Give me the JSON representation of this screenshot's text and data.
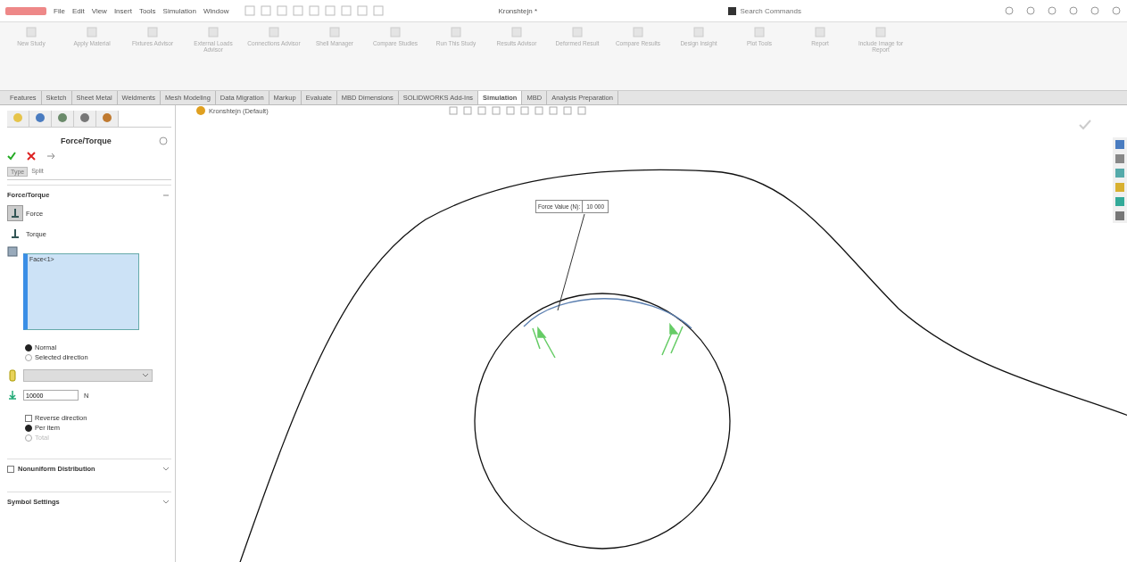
{
  "app": {
    "menu": [
      "File",
      "Edit",
      "View",
      "Insert",
      "Tools",
      "Simulation",
      "Window"
    ],
    "document_title": "Kronshtejn *",
    "search": {
      "placeholder": "Search Commands"
    }
  },
  "ribbon": [
    {
      "label": "New Study"
    },
    {
      "label": "Apply Material"
    },
    {
      "label": "Fixtures Advisor"
    },
    {
      "label": "External Loads Advisor"
    },
    {
      "label": "Connections Advisor"
    },
    {
      "label": "Shell Manager"
    },
    {
      "label": "Compare Studies"
    },
    {
      "label": "Run This Study"
    },
    {
      "label": "Results Advisor"
    },
    {
      "label": "Deformed Result"
    },
    {
      "label": "Compare Results"
    },
    {
      "label": "Design Insight"
    },
    {
      "label": "Plot Tools"
    },
    {
      "label": "Report"
    },
    {
      "label": "Include Image for Report"
    }
  ],
  "tabs": [
    {
      "label": "Features",
      "selected": false
    },
    {
      "label": "Sketch",
      "selected": false
    },
    {
      "label": "Sheet Metal",
      "selected": false
    },
    {
      "label": "Weldments",
      "selected": false
    },
    {
      "label": "Mesh Modeling",
      "selected": false
    },
    {
      "label": "Data Migration",
      "selected": false
    },
    {
      "label": "Markup",
      "selected": false
    },
    {
      "label": "Evaluate",
      "selected": false
    },
    {
      "label": "MBD Dimensions",
      "selected": false
    },
    {
      "label": "SOLIDWORKS Add-Ins",
      "selected": false
    },
    {
      "label": "Simulation",
      "selected": true
    },
    {
      "label": "MBD",
      "selected": false
    },
    {
      "label": "Analysis Preparation",
      "selected": false
    }
  ],
  "panel": {
    "title": "Force/Torque",
    "subtabs": [
      {
        "label": "Type",
        "selected": true
      },
      {
        "label": "Split",
        "selected": false
      }
    ],
    "section": "Force/Torque",
    "load_types": [
      {
        "label": "Force",
        "selected": true
      },
      {
        "label": "Torque",
        "selected": false
      }
    ],
    "faces": [
      "Face<1>"
    ],
    "direction": [
      {
        "label": "Normal",
        "selected": true
      },
      {
        "label": "Selected direction",
        "selected": false
      }
    ],
    "value": "10000",
    "unit": "N",
    "reverse": {
      "label": "Reverse direction",
      "checked": false
    },
    "distribution": [
      {
        "label": "Per item",
        "selected": true,
        "disabled": false
      },
      {
        "label": "Total",
        "selected": false,
        "disabled": true
      }
    ],
    "collapsed": [
      {
        "kind": "checkbox",
        "label": "Nonuniform Distribution",
        "checked": false
      },
      {
        "kind": "plain",
        "label": "Symbol Settings"
      }
    ]
  },
  "viewport": {
    "breadcrumb": "Kronshtejn (Default)",
    "callout": {
      "label": "Force Value (N):",
      "value": "10 000"
    }
  }
}
